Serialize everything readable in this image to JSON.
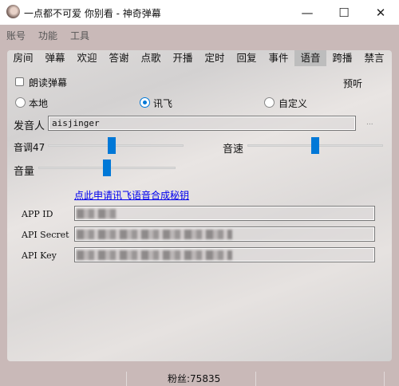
{
  "window": {
    "title": "一点都不可爱 你别看 - 神奇弹幕",
    "minimize": "—",
    "maximize": "☐",
    "close": "✕"
  },
  "menu": [
    "账号",
    "功能",
    "工具"
  ],
  "tabs": [
    {
      "label": "房间"
    },
    {
      "label": "弹幕"
    },
    {
      "label": "欢迎"
    },
    {
      "label": "答谢"
    },
    {
      "label": "点歌"
    },
    {
      "label": "开播"
    },
    {
      "label": "定时"
    },
    {
      "label": "回复"
    },
    {
      "label": "事件"
    },
    {
      "label": "语音",
      "active": true
    },
    {
      "label": "跨播"
    },
    {
      "label": "禁言"
    }
  ],
  "voice": {
    "read_danmaku": {
      "label": "朗读弹幕",
      "checked": false
    },
    "preview": "预听",
    "engines": [
      {
        "label": "本地",
        "selected": false
      },
      {
        "label": "讯飞",
        "selected": true
      },
      {
        "label": "自定义",
        "selected": false
      }
    ],
    "speaker_label": "发音人",
    "speaker_value": "aisjinger",
    "more": "...",
    "pitch": {
      "label": "音调47",
      "value": 0.47
    },
    "speed": {
      "label": "音速",
      "value": 0.5
    },
    "volume": {
      "label": "音量",
      "value": 0.5
    },
    "apply_link": "点此申请讯飞语音合成秘钥",
    "app_id_label": "APP ID",
    "api_secret_label": "API Secret",
    "api_key_label": "API Key"
  },
  "status": {
    "fans": "粉丝:75835"
  },
  "colors": {
    "accent": "#0078d7",
    "bg": "#c9b9b8",
    "link": "#0000ee"
  }
}
